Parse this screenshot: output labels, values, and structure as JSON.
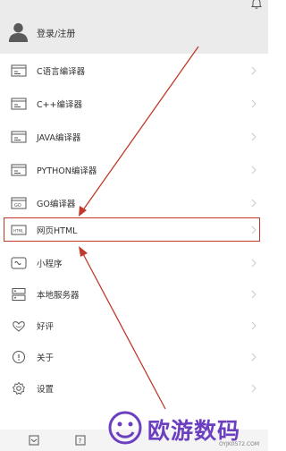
{
  "account": {
    "login_label": "登录/注册"
  },
  "menu": [
    {
      "label": "C语言编译器",
      "icon": "c-compiler-icon"
    },
    {
      "label": "C++编译器",
      "icon": "cpp-compiler-icon"
    },
    {
      "label": "JAVA编译器",
      "icon": "java-compiler-icon"
    },
    {
      "label": "PYTHON编译器",
      "icon": "python-compiler-icon"
    },
    {
      "label": "GO编译器",
      "icon": "go-compiler-icon"
    },
    {
      "label": "网页HTML",
      "icon": "html-icon"
    },
    {
      "label": "小程序",
      "icon": "mini-program-icon"
    },
    {
      "label": "本地服务器",
      "icon": "server-icon"
    },
    {
      "label": "好评",
      "icon": "rate-icon"
    },
    {
      "label": "关于",
      "icon": "about-icon"
    },
    {
      "label": "设置",
      "icon": "settings-icon"
    }
  ],
  "watermark": {
    "brand": "欧游数码",
    "url": "OYJK0572.COM"
  },
  "colors": {
    "highlight": "#c0392b",
    "watermark": "#6b3fbf"
  }
}
